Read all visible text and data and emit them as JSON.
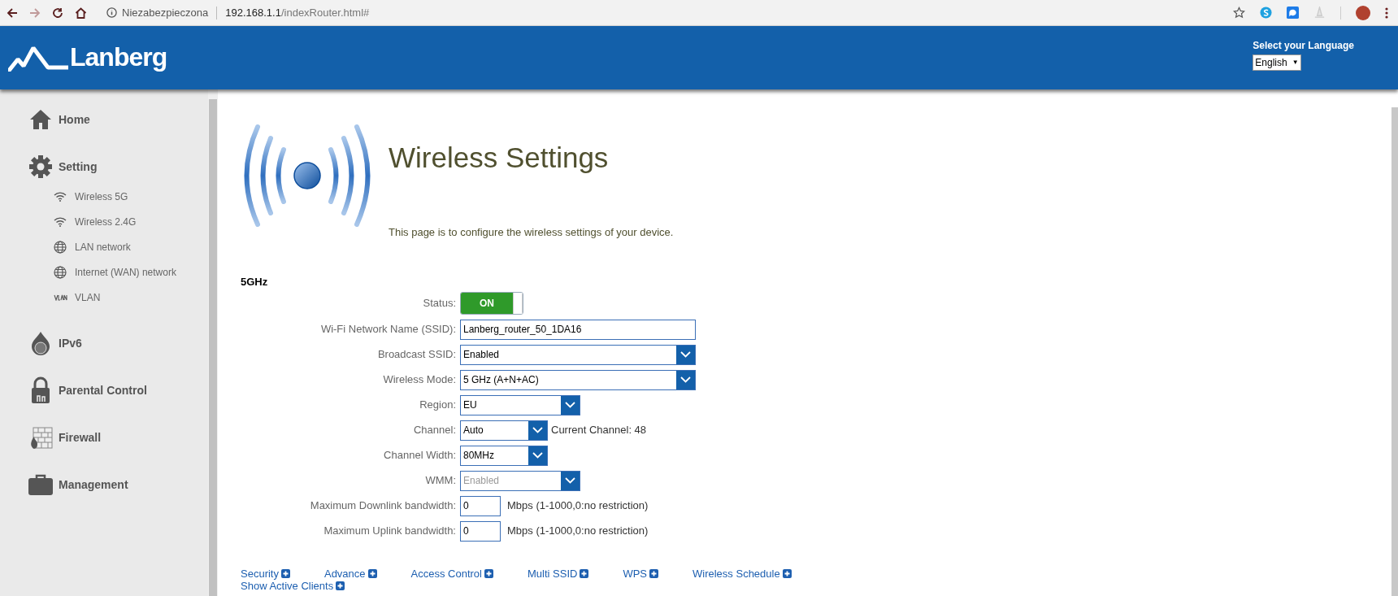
{
  "browser": {
    "security_label": "Niezabezpieczona",
    "url_host": "192.168.1.1",
    "url_path": "/indexRouter.html#"
  },
  "header": {
    "logo": "Lanberg",
    "language_label": "Select your Language",
    "language": "English",
    "language_caret": "▼"
  },
  "sidebar": {
    "items": [
      {
        "label": "Home"
      },
      {
        "label": "Setting",
        "children": [
          {
            "label": "Wireless 5G"
          },
          {
            "label": "Wireless 2.4G"
          },
          {
            "label": "LAN network"
          },
          {
            "label": "Internet (WAN) network"
          },
          {
            "label": "VLAN"
          }
        ]
      },
      {
        "label": "IPv6"
      },
      {
        "label": "Parental Control"
      },
      {
        "label": "Firewall"
      },
      {
        "label": "Management"
      }
    ]
  },
  "page": {
    "title": "Wireless Settings",
    "description": "This page is to configure the wireless settings of your device."
  },
  "section": {
    "title": "5GHz",
    "fields": [
      {
        "kind": "toggle",
        "label": "Status:",
        "value": "ON",
        "on": true
      },
      {
        "kind": "text",
        "label": "Wi-Fi Network Name (SSID):",
        "value": "Lanberg_router_50_1DA16"
      },
      {
        "kind": "select",
        "label": "Broadcast SSID:",
        "value": "Enabled",
        "disabled": false
      },
      {
        "kind": "select",
        "label": "Wireless Mode:",
        "value": "5 GHz (A+N+AC)",
        "disabled": false
      },
      {
        "kind": "select",
        "label": "Region:",
        "value": "EU",
        "disabled": false
      },
      {
        "kind": "select",
        "label": "Channel:",
        "value": "Auto",
        "disabled": false,
        "note": "Current Channel: 48"
      },
      {
        "kind": "select",
        "label": "Channel Width:",
        "value": "80MHz",
        "disabled": false
      },
      {
        "kind": "select",
        "label": "WMM:",
        "value": "Enabled",
        "disabled": true
      },
      {
        "kind": "text",
        "label": "Maximum Downlink bandwidth:",
        "value": "0",
        "note": "Mbps (1-1000,0:no restriction)"
      },
      {
        "kind": "text",
        "label": "Maximum Uplink bandwidth:",
        "value": "0",
        "note": "Mbps (1-1000,0:no restriction)"
      }
    ]
  },
  "links": [
    "Security",
    "Advance",
    "Access Control",
    "Multi SSID",
    "WPS",
    "Wireless Schedule",
    "Show Active Clients"
  ]
}
